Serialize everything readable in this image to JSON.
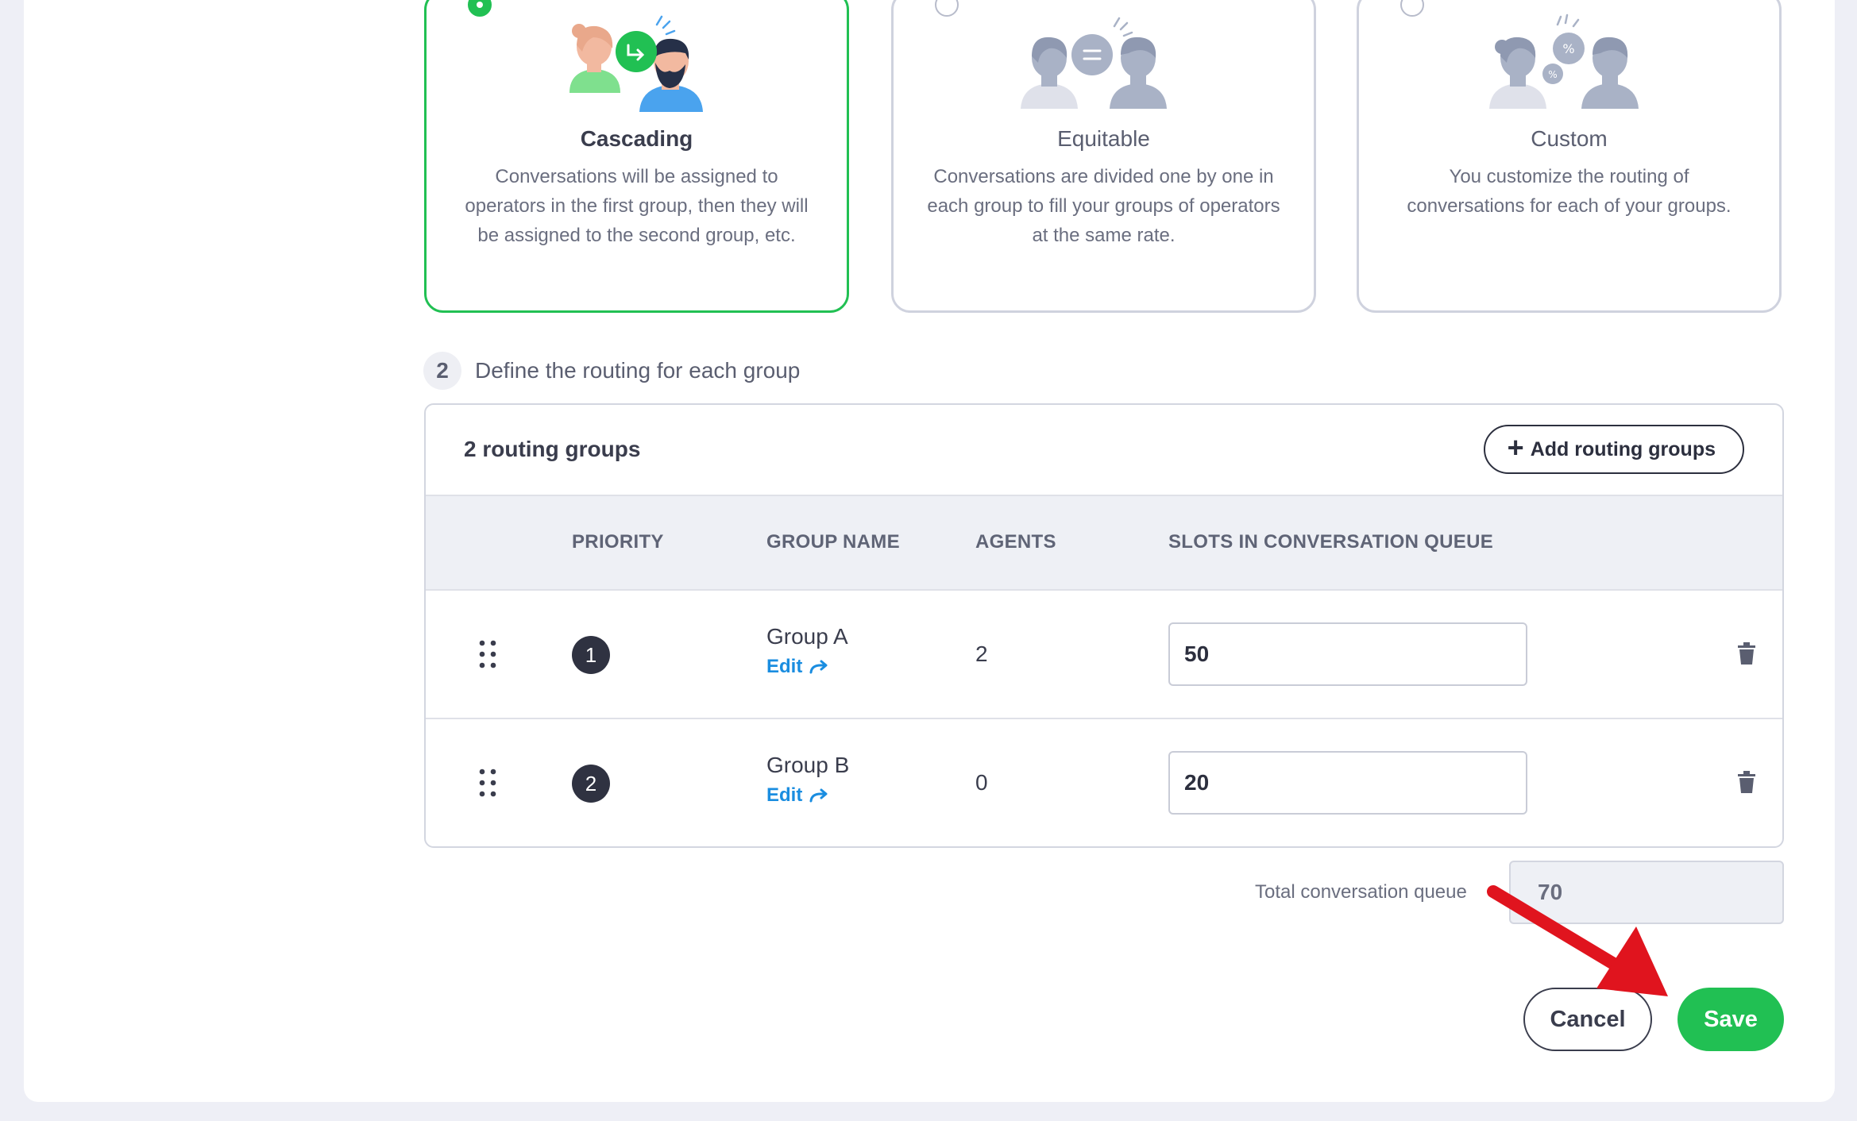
{
  "strategies": [
    {
      "title": "Cascading",
      "description": "Conversations will be assigned to operators in the first group, then they will be assigned to the second group, etc.",
      "selected": true
    },
    {
      "title": "Equitable",
      "description": "Conversations are divided one by one in each group to fill your groups of operators at the same rate.",
      "selected": false
    },
    {
      "title": "Custom",
      "description": "You customize the routing of conversations for each of your groups.",
      "selected": false
    }
  ],
  "step2": {
    "number": "2",
    "label": "Define the routing for each group"
  },
  "routing": {
    "count_label": "2 routing groups",
    "add_button": "Add routing groups",
    "columns": {
      "priority": "PRIORITY",
      "group_name": "GROUP NAME",
      "agents": "AGENTS",
      "slots": "SLOTS IN CONVERSATION QUEUE"
    },
    "rows": [
      {
        "priority": "1",
        "name": "Group A",
        "edit": "Edit",
        "agents": "2",
        "slots": "50"
      },
      {
        "priority": "2",
        "name": "Group B",
        "edit": "Edit",
        "agents": "0",
        "slots": "20"
      }
    ]
  },
  "total": {
    "label": "Total conversation queue",
    "value": "70"
  },
  "actions": {
    "cancel": "Cancel",
    "save": "Save"
  },
  "colors": {
    "accent": "#21c053",
    "link": "#1a8de0",
    "annotation_arrow": "#e0141e"
  }
}
